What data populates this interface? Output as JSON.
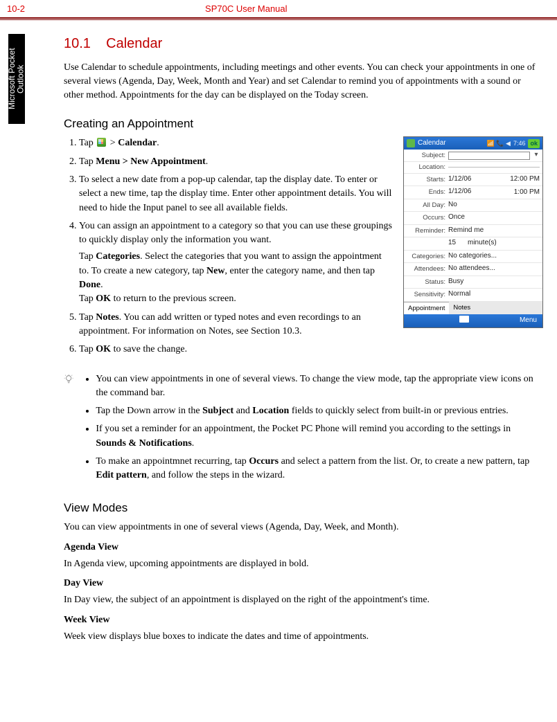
{
  "header": {
    "pageNumber": "10-2",
    "docTitle": "SP70C User Manual"
  },
  "sideTab": "Microsoft Pocket Outlook",
  "section": {
    "number": "10.1",
    "title": "Calendar"
  },
  "intro": "Use Calendar to schedule appointments, including meetings and other events. You can check your appointments in one of several views (Agenda, Day, Week, Month and Year) and set Calendar to remind you of appointments with a sound or other method. Appointments for the day can be displayed on the Today screen.",
  "creating": {
    "heading": "Creating an Appointment",
    "step1_pre": "Tap ",
    "step1_post": " > ",
    "step1_bold": "Calendar",
    "step1_end": ".",
    "step2_pre": "Tap ",
    "step2_bold": "Menu > New Appointment",
    "step2_end": ".",
    "step3": "To select a new date from a pop-up calendar, tap the display date. To enter or select a new time, tap the display time. Enter other appointment details. You will need to hide the Input panel to see all available fields.",
    "step4a": "You can assign an appointment to a category so that you can use these groupings to quickly display only the information you want.",
    "step4b_pre": "Tap ",
    "step4b_b1": "Categories",
    "step4b_mid1": ". Select the categories that you want to assign the appointment to. To create a new category, tap ",
    "step4b_b2": "New",
    "step4b_mid2": ", enter the category name, and then tap ",
    "step4b_b3": "Done",
    "step4b_end": ".",
    "step4c_pre": "Tap ",
    "step4c_b": "OK",
    "step4c_end": " to return to the previous screen.",
    "step5_pre": "Tap ",
    "step5_b": "Notes",
    "step5_end": ". You can add written or typed notes and even recordings to an appointment. For information on Notes, see Section 10.3.",
    "step6_pre": "Tap ",
    "step6_b": "OK",
    "step6_end": " to save the change."
  },
  "tips": {
    "t1": "You can view appointments in one of several views. To change the view mode, tap the appropriate view icons on the command bar.",
    "t2_pre": "Tap the Down arrow in the ",
    "t2_b1": "Subject",
    "t2_mid": " and ",
    "t2_b2": "Location",
    "t2_end": " fields to quickly select from built-in or previous entries.",
    "t3_pre": "If you set a reminder for an appointment, the Pocket PC Phone will remind you according to the settings in ",
    "t3_b": "Sounds & Notifications",
    "t3_end": ".",
    "t4_pre": "To make an appointmnet recurring, tap ",
    "t4_b1": "Occurs",
    "t4_mid": " and select a pattern from the list. Or, to create a new pattern, tap ",
    "t4_b2": "Edit pattern",
    "t4_end": ", and follow the steps in the wizard."
  },
  "viewModes": {
    "heading": "View Modes",
    "intro": "You can view appointments in one of several views (Agenda, Day, Week, and Month).",
    "agendaH": "Agenda View",
    "agendaP": "In Agenda view, upcoming appointments are displayed in bold.",
    "dayH": "Day View",
    "dayP": "In Day view, the subject of an appointment is displayed on the right of the appointment's time.",
    "weekH": "Week View",
    "weekP": "Week view displays blue boxes to indicate the dates and time of appointments."
  },
  "device": {
    "title": "Calendar",
    "clock": "7:46",
    "ok": "ok",
    "fields": {
      "subject": "Subject:",
      "location": "Location:",
      "starts": "Starts:",
      "startsV": "1/12/06",
      "startsT": "12:00 PM",
      "ends": "Ends:",
      "endsV": "1/12/06",
      "endsT": "1:00 PM",
      "allday": "All Day:",
      "alldayV": "No",
      "occurs": "Occurs:",
      "occursV": "Once",
      "reminder": "Reminder:",
      "reminderV": "Remind me",
      "reminder2V": "15",
      "reminder2U": "minute(s)",
      "categories": "Categories:",
      "categoriesV": "No categories...",
      "attendees": "Attendees:",
      "attendeesV": "No attendees...",
      "status": "Status:",
      "statusV": "Busy",
      "sensitivity": "Sensitivity:",
      "sensitivityV": "Normal"
    },
    "tabs": {
      "t1": "Appointment",
      "t2": "Notes"
    },
    "softbar": {
      "menu": "Menu"
    }
  }
}
